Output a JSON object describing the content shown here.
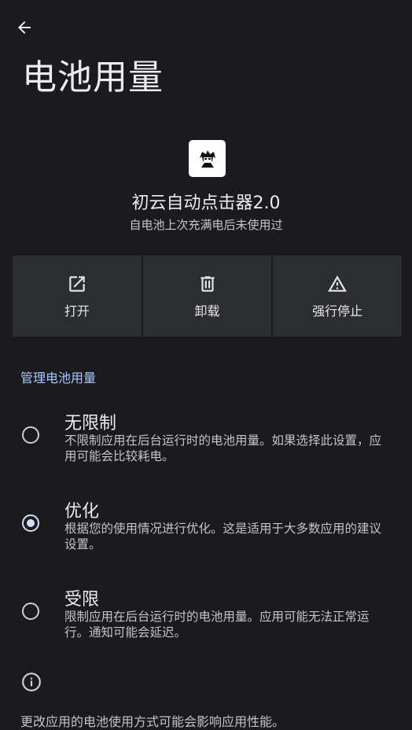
{
  "header": {
    "title": "电池用量",
    "back_icon": "arrow-back-icon"
  },
  "app": {
    "name": "初云自动点击器2.0",
    "subtitle": "自电池上次充满电后未使用过"
  },
  "actions": [
    {
      "label": "打开",
      "icon": "open-external-icon"
    },
    {
      "label": "卸载",
      "icon": "trash-icon"
    },
    {
      "label": "强行停止",
      "icon": "warning-icon"
    }
  ],
  "section_title": "管理电池用量",
  "options": [
    {
      "title": "无限制",
      "desc": "不限制应用在后台运行时的电池用量。如果选择此设置，应用可能会比较耗电。",
      "selected": false
    },
    {
      "title": "优化",
      "desc": "根据您的使用情况进行优化。这是适用于大多数应用的建议设置。",
      "selected": true
    },
    {
      "title": "受限",
      "desc": "限制应用在后台运行时的电池用量。应用可能无法正常运行。通知可能会延迟。",
      "selected": false
    }
  ],
  "footer": {
    "text": "更改应用的电池使用方式可能会影响应用性能。",
    "icon": "info-icon"
  },
  "colors": {
    "background": "#1b1b1d",
    "card": "#2b2d31",
    "accent": "#a9c7ff",
    "radio_selected": "#cfe0ff"
  }
}
